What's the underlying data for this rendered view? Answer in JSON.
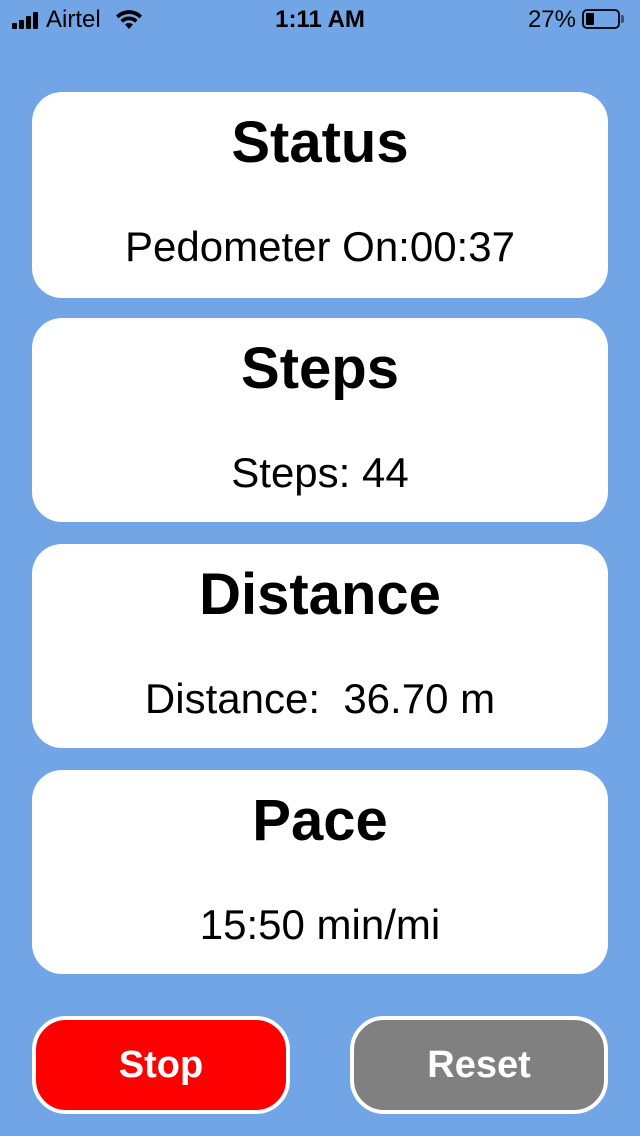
{
  "status_bar": {
    "carrier": "Airtel",
    "time": "1:11 AM",
    "battery_percent": "27%",
    "battery_level": 0.27,
    "icons": [
      "signal-icon",
      "wifi-icon",
      "battery-icon"
    ]
  },
  "cards": {
    "status": {
      "title": "Status",
      "value": "Pedometer On:00:37"
    },
    "steps": {
      "title": "Steps",
      "value": "Steps: 44"
    },
    "distance": {
      "title": "Distance",
      "value": "Distance:  36.70 m"
    },
    "pace": {
      "title": "Pace",
      "value": "15:50 min/mi"
    }
  },
  "buttons": {
    "stop_label": "Stop",
    "reset_label": "Reset"
  },
  "colors": {
    "background": "#72a5e5",
    "stop": "#ff0000",
    "reset": "#808080",
    "card": "#ffffff"
  }
}
